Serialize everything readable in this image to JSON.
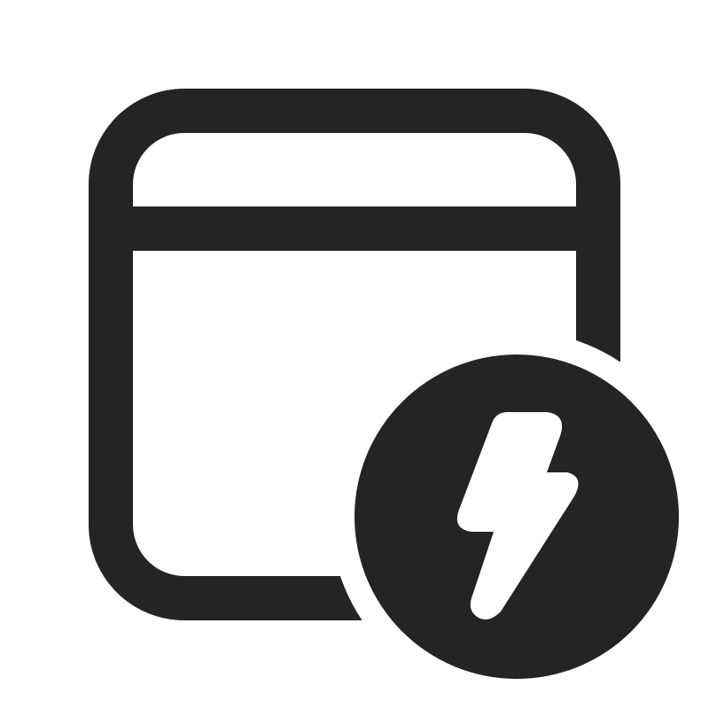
{
  "icon": {
    "name": "calendar-lightning-icon",
    "color": "#242424",
    "background": "#ffffff",
    "parts": [
      "calendar-frame",
      "header-divider",
      "lightning-badge",
      "lightning-bolt"
    ]
  }
}
